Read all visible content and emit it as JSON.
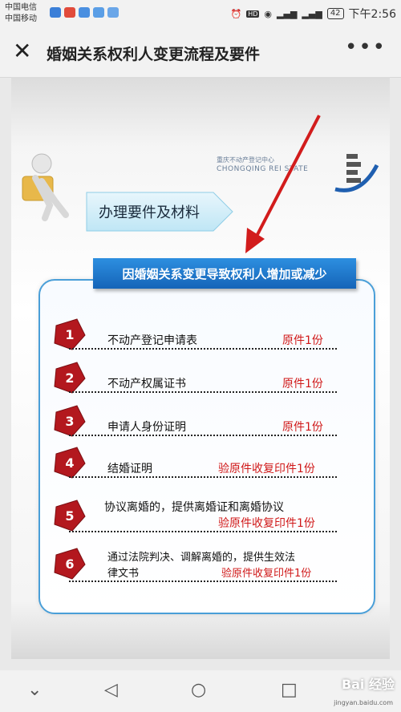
{
  "status_bar": {
    "carrier1": "中国电信",
    "carrier2": "中国移动",
    "battery": "42",
    "time": "下午2:56"
  },
  "header": {
    "title": "婚姻关系权利人变更流程及要件",
    "close_icon": "close-icon",
    "more_icon": "more-icon"
  },
  "article": {
    "logo_cn": "重庆不动产登记中心",
    "logo_en": "CHONGQING REI STATE",
    "section_label": "办理要件及材料",
    "banner": "因婚姻关系变更导致权利人增加或减少",
    "items": [
      {
        "num": "1",
        "name": "不动产登记申请表",
        "req": "原件1份"
      },
      {
        "num": "2",
        "name": "不动产权属证书",
        "req": "原件1份"
      },
      {
        "num": "3",
        "name": "申请人身份证明",
        "req": "原件1份"
      },
      {
        "num": "4",
        "name": "结婚证明",
        "req": "验原件收复印件1份"
      },
      {
        "num": "5",
        "name": "协议离婚的，提供离婚证和离婚协议",
        "req": "验原件收复印件1份"
      },
      {
        "num": "6",
        "name": "通过法院判决、调解离婚的，提供生效法",
        "name2": "律文书",
        "req": "验原件收复印件1份"
      }
    ]
  },
  "watermark": {
    "brand": "Bai 经验",
    "url": "jingyan.baidu.com"
  },
  "colors": {
    "banner_blue": "#1f78cc",
    "badge_red": "#b3181e",
    "req_red": "#d01818",
    "panel_border": "#4a9fd8"
  }
}
